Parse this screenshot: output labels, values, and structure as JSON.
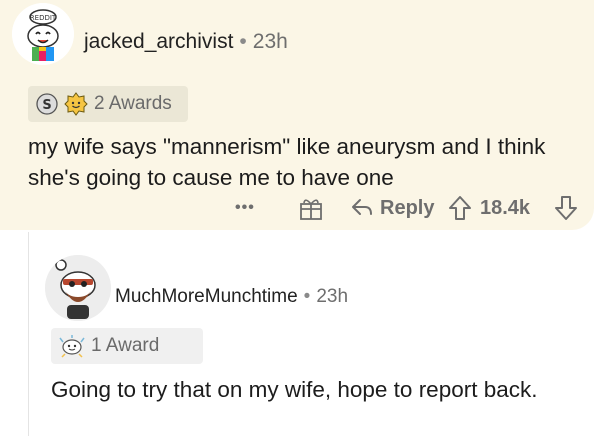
{
  "comment1": {
    "username": "jacked_archivist",
    "separator": "•",
    "time": "23h",
    "awards_label": "2 Awards",
    "body": "my wife says \"mannerism\" like aneurysm and I think she's going to cause me to have one",
    "actions": {
      "more_label": "•••",
      "reply_label": "Reply",
      "score": "18.4k"
    }
  },
  "comment2": {
    "username": "MuchMoreMunchtime",
    "separator": "•",
    "time": "23h",
    "awards_label": "1 Award",
    "body": "Going to try that on my wife, hope to report back."
  },
  "colors": {
    "highlight_bg": "#fbf6e6",
    "award_bg": "#ebe7d6",
    "meta_gray": "#6e6e6e"
  }
}
